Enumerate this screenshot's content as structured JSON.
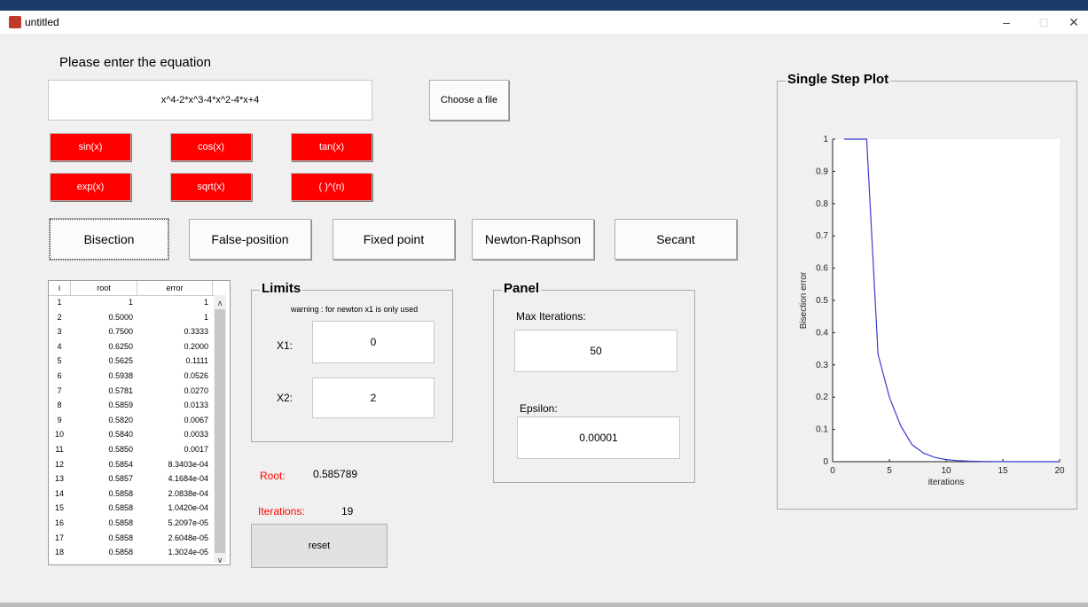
{
  "window": {
    "title": "untitled",
    "min": "–",
    "max": "□",
    "close": "✕"
  },
  "prompt": "Please enter the equation",
  "equation": "x^4-2*x^3-4*x^2-4*x+4",
  "choose_file": "Choose a file",
  "func_buttons": [
    "sin(x)",
    "cos(x)",
    "tan(x)",
    "exp(x)",
    "sqrt(x)",
    "( )^(n)"
  ],
  "methods": [
    "Bisection",
    "False-position",
    "Fixed point",
    "Newton-Raphson",
    "Secant"
  ],
  "selected_method": "Bisection",
  "table": {
    "headers": [
      "i",
      "root",
      "error"
    ],
    "rows": [
      [
        "1",
        "1",
        "1"
      ],
      [
        "2",
        "0.5000",
        "1"
      ],
      [
        "3",
        "0.7500",
        "0.3333"
      ],
      [
        "4",
        "0.6250",
        "0.2000"
      ],
      [
        "5",
        "0.5625",
        "0.1111"
      ],
      [
        "6",
        "0.5938",
        "0.0526"
      ],
      [
        "7",
        "0.5781",
        "0.0270"
      ],
      [
        "8",
        "0.5859",
        "0.0133"
      ],
      [
        "9",
        "0.5820",
        "0.0067"
      ],
      [
        "10",
        "0.5840",
        "0.0033"
      ],
      [
        "11",
        "0.5850",
        "0.0017"
      ],
      [
        "12",
        "0.5854",
        "8.3403e-04"
      ],
      [
        "13",
        "0.5857",
        "4.1684e-04"
      ],
      [
        "14",
        "0.5858",
        "2.0838e-04"
      ],
      [
        "15",
        "0.5858",
        "1.0420e-04"
      ],
      [
        "16",
        "0.5858",
        "5.2097e-05"
      ],
      [
        "17",
        "0.5858",
        "2.6048e-05"
      ],
      [
        "18",
        "0.5858",
        "1.3024e-05"
      ]
    ]
  },
  "limits": {
    "title": "Limits",
    "warning": "warning : for newton x1 is only used",
    "x1_label": "X1:",
    "x1_value": "0",
    "x2_label": "X2:",
    "x2_value": "2"
  },
  "panel": {
    "title": "Panel",
    "max_iter_label": "Max Iterations:",
    "max_iter_value": "50",
    "eps_label": "Epsilon:",
    "eps_value": "0.00001"
  },
  "result": {
    "root_label": "Root:",
    "root_value": "0.585789",
    "iter_label": "Iterations:",
    "iter_value": "19"
  },
  "reset": "reset",
  "plot_title": "Single Step Plot",
  "colors": {
    "accent_red": "#ff0000",
    "line_blue": "#3b3bd0"
  },
  "chart_data": {
    "type": "line",
    "xlabel": "iterations",
    "ylabel": "Bisection error",
    "xlim": [
      0,
      20
    ],
    "ylim": [
      0,
      1
    ],
    "xticks": [
      "0",
      "5",
      "10",
      "15",
      "20"
    ],
    "yticks": [
      "0",
      "0.1",
      "0.2",
      "0.3",
      "0.4",
      "0.5",
      "0.6",
      "0.7",
      "0.8",
      "0.9",
      "1"
    ],
    "x": [
      1,
      2,
      3,
      4,
      5,
      6,
      7,
      8,
      9,
      10,
      11,
      12,
      13,
      14,
      15,
      16,
      17,
      18,
      19,
      20
    ],
    "y": [
      1,
      1,
      1,
      0.3333,
      0.2,
      0.1111,
      0.0526,
      0.027,
      0.0133,
      0.0067,
      0.0033,
      0.0017,
      0.00083,
      0.00042,
      0.00021,
      0.0001,
      5e-05,
      2.6e-05,
      1.3e-05,
      1.3e-05
    ]
  }
}
